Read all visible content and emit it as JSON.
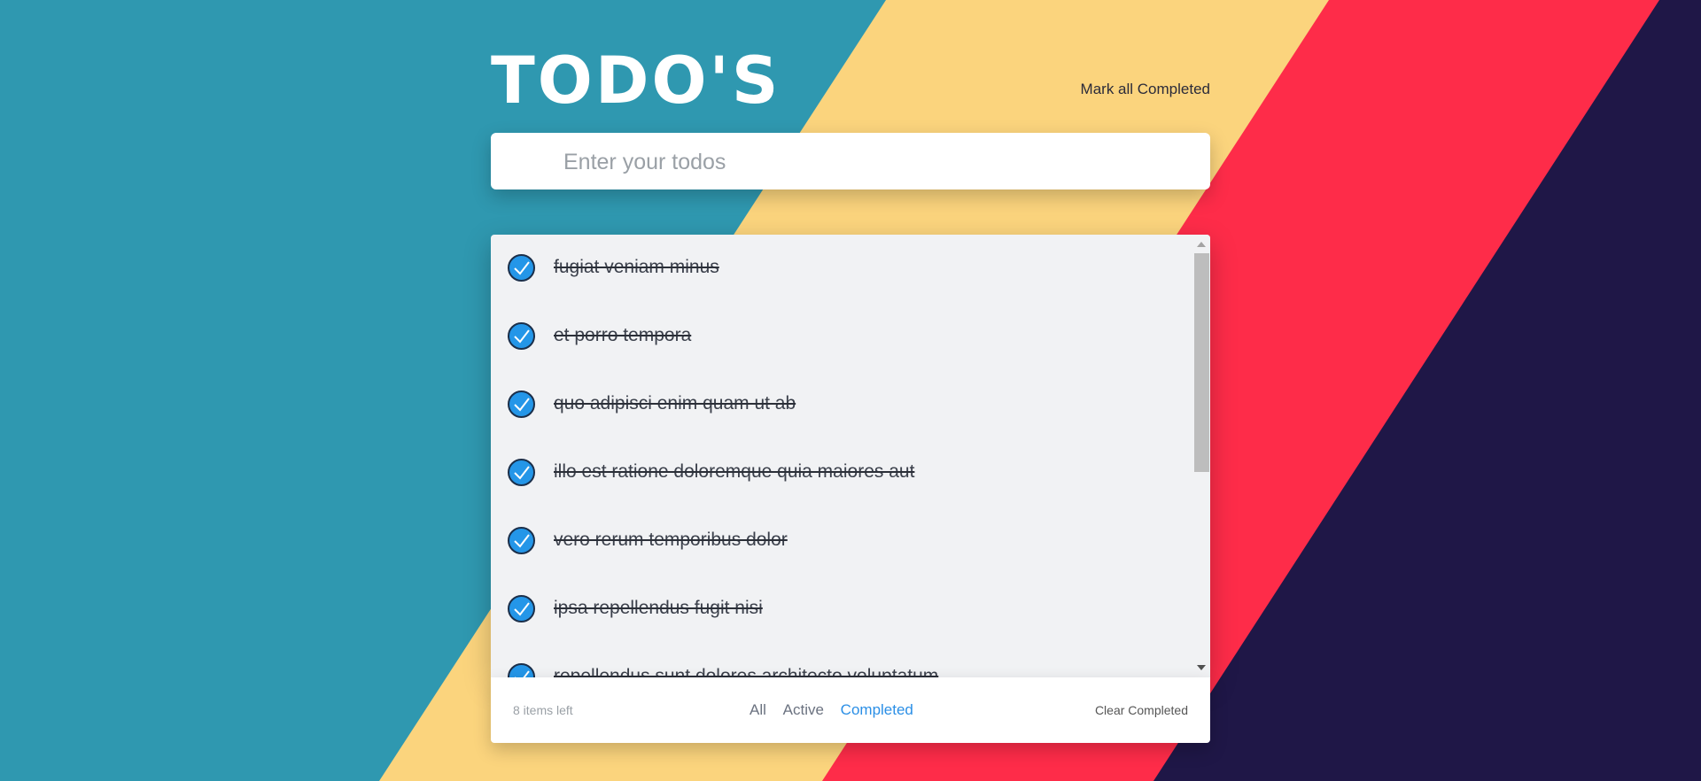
{
  "header": {
    "title": "TODO'S",
    "mark_all_label": "Mark all Completed"
  },
  "input": {
    "placeholder": "Enter your todos",
    "value": ""
  },
  "todos": [
    {
      "text": "fugiat veniam minus",
      "completed": true
    },
    {
      "text": "et porro tempora",
      "completed": true
    },
    {
      "text": "quo adipisci enim quam ut ab",
      "completed": true
    },
    {
      "text": "illo est ratione doloremque quia maiores aut",
      "completed": true
    },
    {
      "text": "vero rerum temporibus dolor",
      "completed": true
    },
    {
      "text": "ipsa repellendus fugit nisi",
      "completed": true
    },
    {
      "text": "repellendus sunt dolores architecto voluptatum",
      "completed": true
    }
  ],
  "footer": {
    "items_left": "8 items left",
    "filters": [
      "All",
      "Active",
      "Completed"
    ],
    "active_filter": "Completed",
    "clear_label": "Clear Completed"
  },
  "colors": {
    "teal": "#2f98b0",
    "yellow": "#fbd47d",
    "red": "#fe2c49",
    "navy": "#1f1747",
    "accent": "#2b8fe6",
    "check": "#2496e8"
  }
}
